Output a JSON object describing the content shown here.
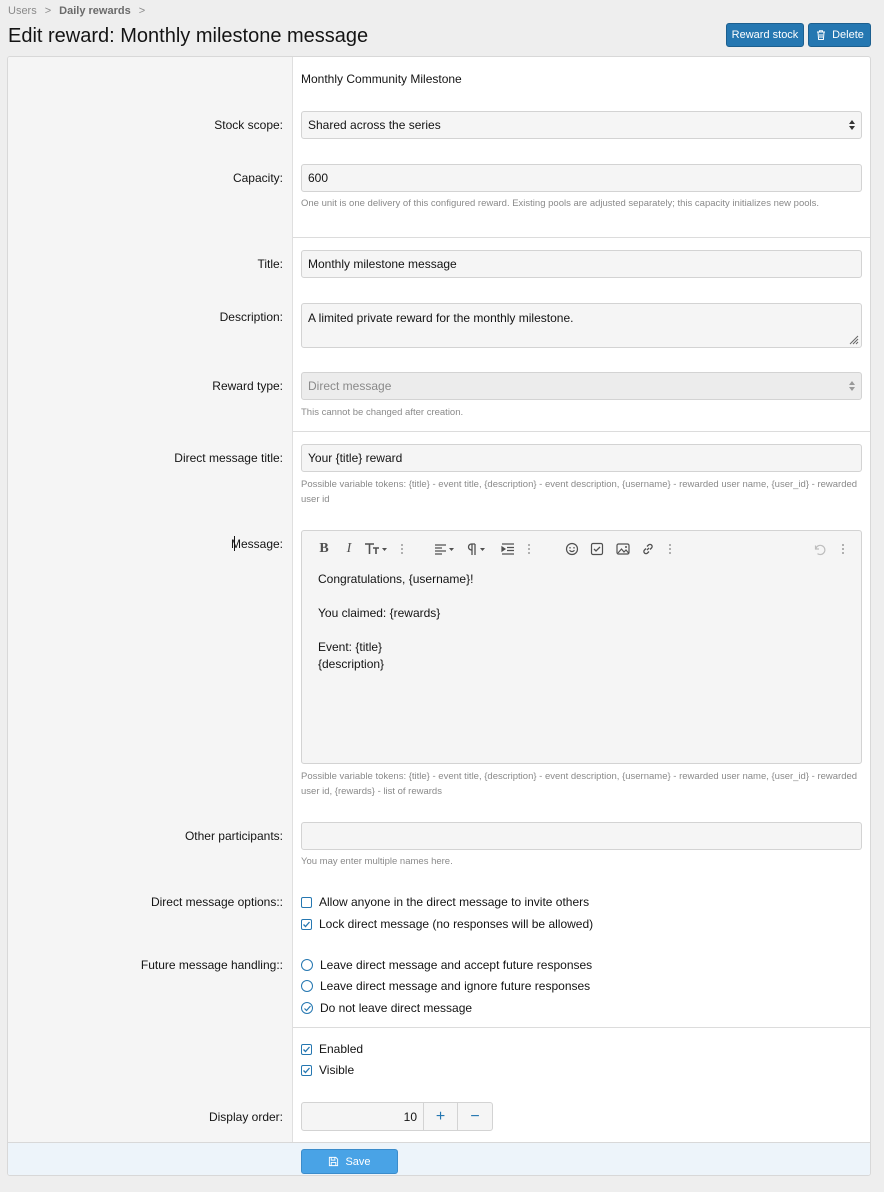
{
  "breadcrumb": {
    "items": [
      "Users",
      "Daily rewards"
    ],
    "separator": ">"
  },
  "page": {
    "title": "Edit reward: Monthly milestone message"
  },
  "actions": {
    "reward_stock": "Reward stock",
    "delete": "Delete"
  },
  "form": {
    "event_name": "Monthly Community Milestone",
    "stock_scope": {
      "label": "Stock scope:",
      "value": "Shared across the series"
    },
    "capacity": {
      "label": "Capacity:",
      "value": "600",
      "hint": "One unit is one delivery of this configured reward. Existing pools are adjusted separately; this capacity initializes new pools."
    },
    "title": {
      "label": "Title:",
      "value": "Monthly milestone message"
    },
    "description": {
      "label": "Description:",
      "value": "A limited private reward for the monthly milestone."
    },
    "reward_type": {
      "label": "Reward type:",
      "value": "Direct message",
      "hint": "This cannot be changed after creation."
    },
    "dm_title": {
      "label": "Direct message title:",
      "value": "Your {title} reward",
      "hint": "Possible variable tokens: {title} - event title, {description} - event description, {username} - rewarded user name, {user_id} - rewarded user id"
    },
    "message": {
      "label": "Message:",
      "lines": [
        "Congratulations, {username}!",
        "",
        "You claimed: {rewards}",
        "",
        "Event: {title}",
        "{description}"
      ],
      "hint": "Possible variable tokens: {title} - event title, {description} - event description, {username} - rewarded user name, {user_id} - rewarded user id, {rewards} - list of rewards"
    },
    "other_participants": {
      "label": "Other participants:",
      "value": "",
      "hint": "You may enter multiple names here."
    },
    "dm_options": {
      "label": "Direct message options::",
      "items": [
        {
          "text": "Allow anyone in the direct message to invite others",
          "checked": false
        },
        {
          "text": "Lock direct message (no responses will be allowed)",
          "checked": true
        }
      ]
    },
    "future_handling": {
      "label": "Future message handling::",
      "items": [
        {
          "text": "Leave direct message and accept future responses",
          "selected": false
        },
        {
          "text": "Leave direct message and ignore future responses",
          "selected": false
        },
        {
          "text": "Do not leave direct message",
          "selected": true
        }
      ]
    },
    "flags": [
      {
        "text": "Enabled",
        "checked": true
      },
      {
        "text": "Visible",
        "checked": true
      }
    ],
    "display_order": {
      "label": "Display order:",
      "value": "10",
      "plus": "+",
      "minus": "−"
    },
    "save_label": "Save"
  },
  "colors": {
    "accent": "#2577b1",
    "save": "#49a3e6",
    "footer": "#edf4fa"
  }
}
